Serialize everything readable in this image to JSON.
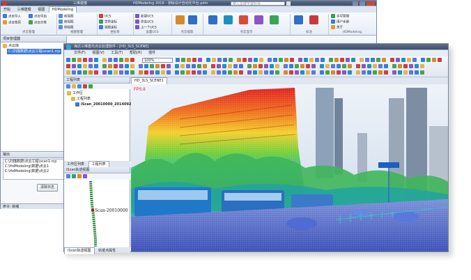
{
  "back_window": {
    "title": "HDModeling 2016 - 测绘设计自动化平台.pdm",
    "quick_tab": "三维建模",
    "tabs": [
      "开始",
      "三维建模",
      "视图",
      "HDModeling"
    ],
    "active_tab": "HDModeling",
    "search_placeholder": "键入关键字或短语",
    "ribbon_groups": [
      {
        "label": "点云管理",
        "items": [
          "点云导入",
          "点云导出",
          "点云裁剪",
          "点云分类"
        ]
      },
      {
        "label": "视图管理",
        "items": [
          "前视图",
          "俯视图",
          "侧视图"
        ]
      },
      {
        "label": "坐标系",
        "items": [
          "UCS",
          "世界坐标",
          "视图坐标",
          "原点"
        ]
      },
      {
        "label": "设置UCS",
        "items": [
          "新建UCS",
          "命名UCS",
          "上一个UCS"
        ]
      },
      {
        "label": "点云提取",
        "items": [
          "提取",
          "面提取"
        ]
      },
      {
        "label": "点云显示",
        "items": [
          "显示",
          "颜色",
          "强度"
        ]
      },
      {
        "label": "标注",
        "items": [
          "标注",
          "测量"
        ]
      },
      {
        "label": "HDModeling",
        "items": [
          "许可管理",
          "用户手册",
          "关于"
        ]
      }
    ],
    "left_panel": {
      "title": "项目管理器",
      "root": "点云库",
      "selected_item": "C:\\扫描数据\\点云工程\\scan1.rcp",
      "log_title": "输出",
      "log_lines": [
        "C:\\扫描数据\\点云工程\\scan1.rcp",
        "C:\\HdModeling\\数据\\点云1",
        "C:\\HdModeling\\数据\\点云2"
      ],
      "button": "清除日志",
      "status": "命令: 就绪"
    }
  },
  "front_window": {
    "title": "海达三维激光点云处理软件 - [HD_3LS_SCENE]",
    "menu": [
      "文件(F)",
      "视图(V)",
      "工具(T)",
      "帮助(H)",
      "插件"
    ],
    "zoom": "100%",
    "view_tab": "HD_3LS_SCENE1",
    "fps": "FPS:8",
    "project_panel": {
      "title": "工程列表",
      "nodes": [
        "工作区",
        "工程列表",
        "iScan_20010000_2014092"
      ]
    },
    "bottom_tabs": [
      "工作区列表",
      "工程列表"
    ],
    "trajectory_panel": {
      "title": "iScan轨迹视图",
      "scan_label": "Scan-20010000",
      "tabs": [
        "iScan轨迹视图",
        "轨迹点属性"
      ]
    }
  },
  "colors": {
    "ribbon_blue": "#2f6fc4",
    "panel_bg": "#f3f6fa",
    "sky": "#e5eef7",
    "trajectory_green": "#2e8b3a",
    "fps_red": "#e02020"
  }
}
